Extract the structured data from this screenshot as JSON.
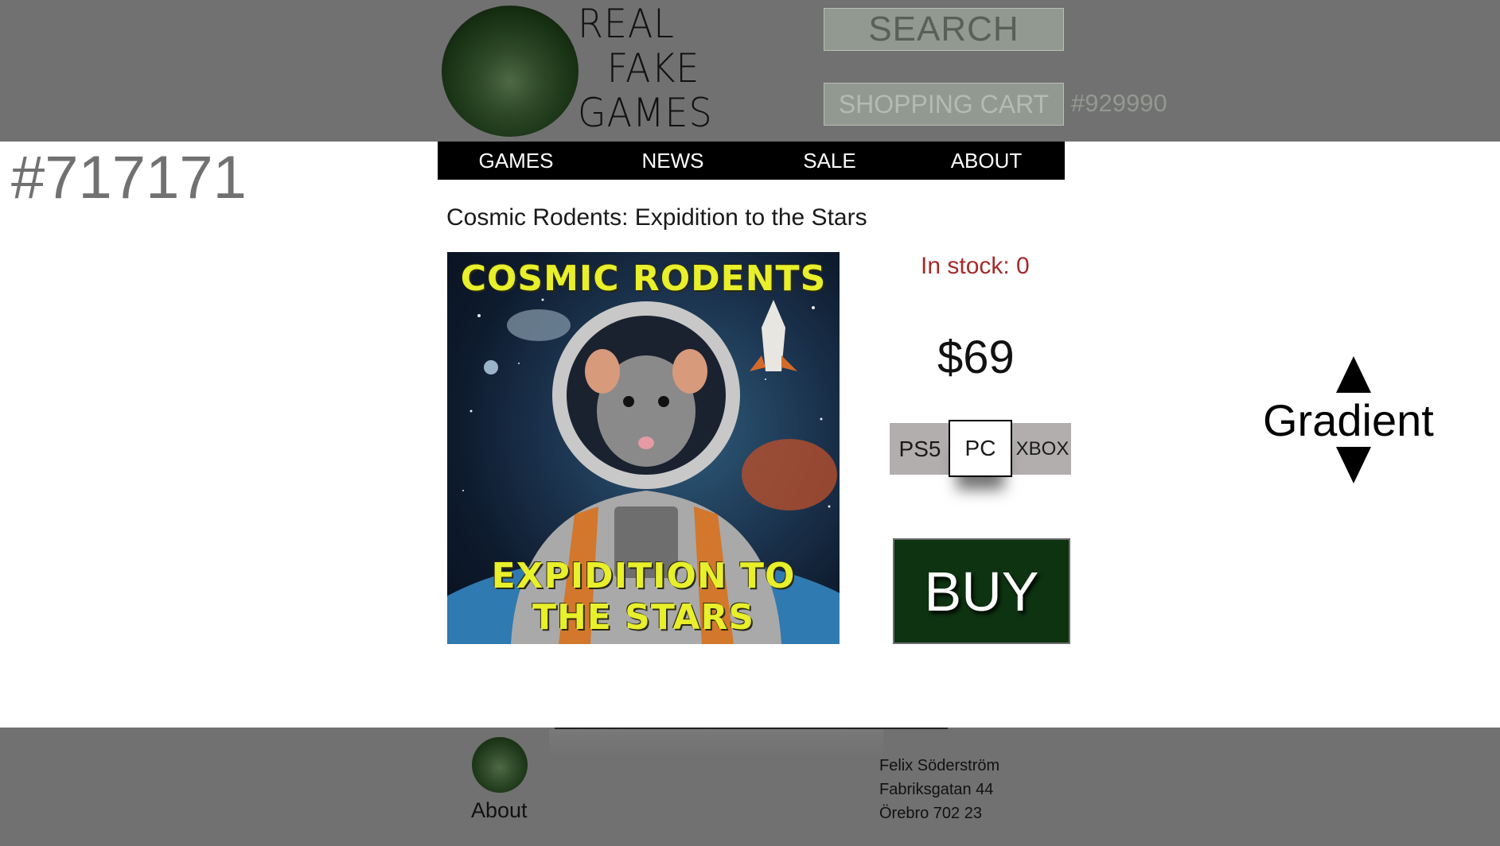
{
  "header": {
    "logo_lines": [
      "REAL",
      "FAKE",
      "GAMES"
    ],
    "search_label": "SEARCH",
    "cart_label": "SHOPPING CART",
    "cart_color_note": "#929990",
    "header_color_note": "#717171"
  },
  "nav": {
    "items": [
      {
        "label": "GAMES"
      },
      {
        "label": "NEWS"
      },
      {
        "label": "SALE"
      },
      {
        "label": "ABOUT"
      }
    ]
  },
  "product": {
    "title": "Cosmic Rodents: Expidition to the Stars",
    "cover_title_top": "COSMIC RODENTS",
    "cover_title_bottom_1": "EXPIDITION TO",
    "cover_title_bottom_2": "THE STARS",
    "stock_text": "In stock: 0",
    "price": "$69",
    "platforms": [
      {
        "label": "PS5",
        "selected": false
      },
      {
        "label": "PC",
        "selected": true
      },
      {
        "label": "XBOX",
        "selected": false
      }
    ],
    "buy_label": "BUY"
  },
  "annotation": {
    "gradient_label": "Gradient"
  },
  "footer": {
    "about_label": "About",
    "address_lines": [
      "Felix Söderström",
      "Fabriksgatan 44",
      "Örebro 702 23"
    ]
  },
  "colors": {
    "header_bg": "#717171",
    "search_bg": "#929990",
    "nav_bg": "#000000",
    "buy_bg": "#0d3310",
    "stock_text": "#a52a2a",
    "cover_text": "#e8ef2b"
  },
  "icons": [
    "logo-circle",
    "arrow-up-icon",
    "arrow-down-icon"
  ]
}
